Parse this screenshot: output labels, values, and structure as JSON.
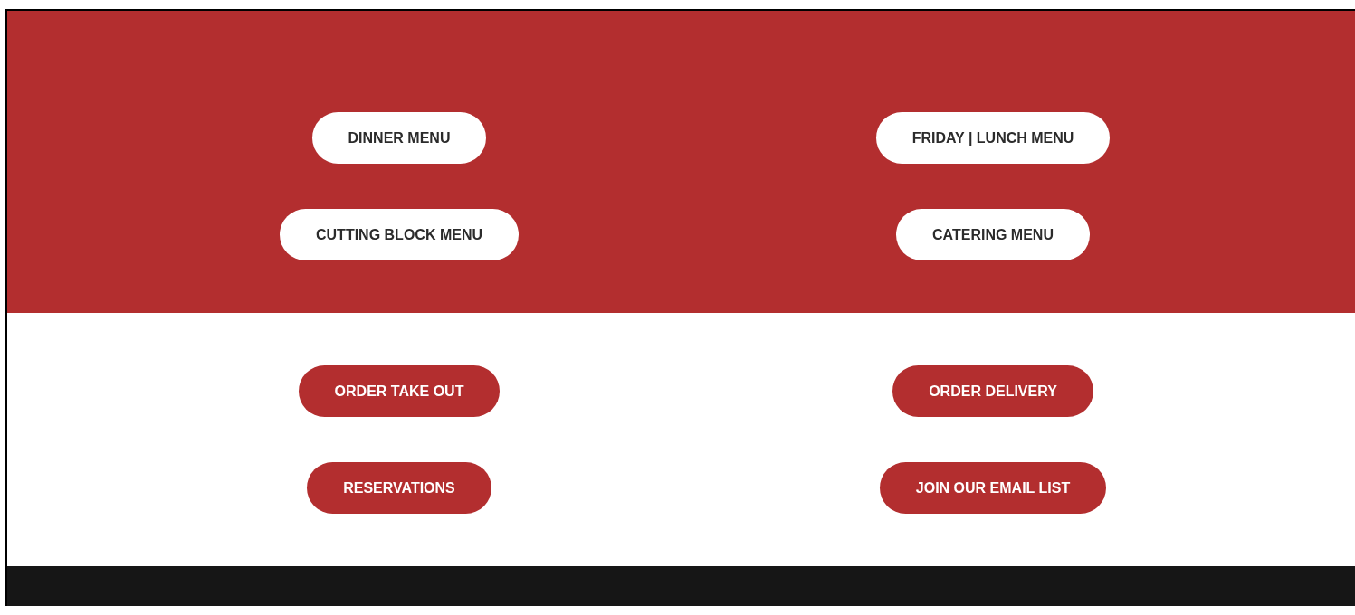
{
  "sections": [
    {
      "kind": "menus",
      "buttons": [
        "DINNER MENU",
        "FRIDAY | LUNCH MENU",
        "CUTTING BLOCK MENU",
        "CATERING MENU"
      ]
    },
    {
      "kind": "actions",
      "buttons": [
        "ORDER TAKE OUT",
        "ORDER DELIVERY",
        "RESERVATIONS",
        "JOIN OUR EMAIL LIST"
      ]
    }
  ]
}
